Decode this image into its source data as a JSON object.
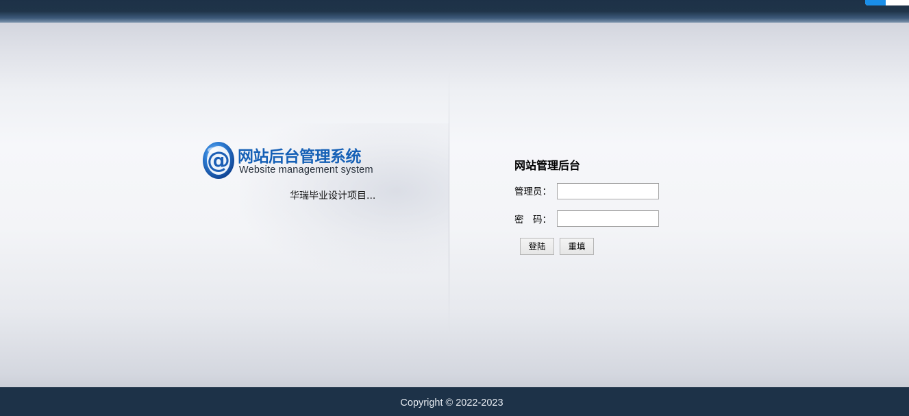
{
  "header": {
    "corner_widget_color": "#1a8ee8"
  },
  "logo": {
    "icon": "at-sign-logo-icon",
    "title": "网站后台管理系统",
    "subtitle": "Website management system",
    "brand_color": "#1560b6"
  },
  "project_note": "华瑞毕业设计项目...",
  "login": {
    "title": "网站管理后台",
    "username_label": "管理员：",
    "username_value": "",
    "password_label": "密　码：",
    "password_value": "",
    "login_button": "登陆",
    "reset_button": "重填"
  },
  "footer": {
    "copyright": "Copyright © 2022-2023",
    "background_color": "#1d3248"
  }
}
